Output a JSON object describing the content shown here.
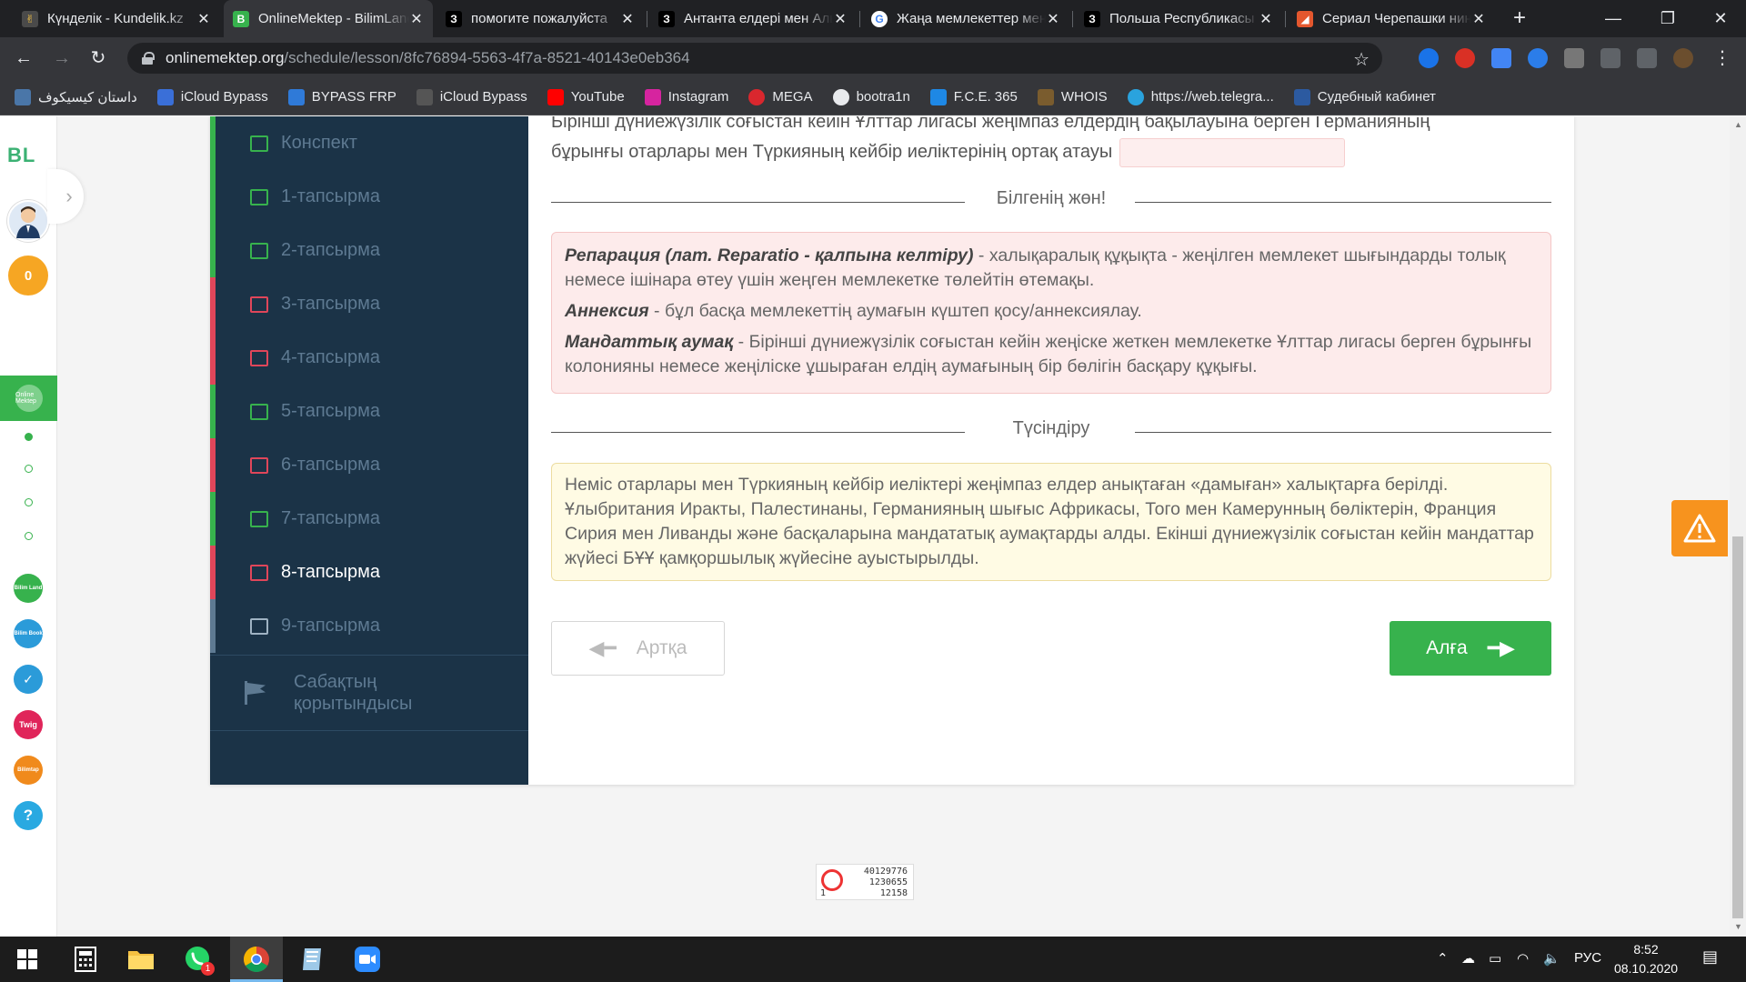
{
  "browser": {
    "tabs": [
      {
        "title": "Күнделік - Kundelik.kz",
        "fav_color": "#4a4a4a",
        "fav_glyph": "✌"
      },
      {
        "title": "OnlineMektep - BilimLand",
        "fav_color": "#37b24d",
        "fav_glyph": "B",
        "active": true
      },
      {
        "title": "помогите пожалуйста",
        "fav_color": "#000000",
        "fav_glyph": "З"
      },
      {
        "title": "Антанта елдері мен Аль",
        "fav_color": "#000000",
        "fav_glyph": "З"
      },
      {
        "title": "Жаңа мемлекеттер мен",
        "fav_color": "#ffffff",
        "fav_glyph": "G"
      },
      {
        "title": "Польша Республикасы",
        "fav_color": "#000000",
        "fav_glyph": "З"
      },
      {
        "title": "Сериал Черепашки ниндзя",
        "fav_color": "#e4572e",
        "fav_glyph": "◢"
      }
    ],
    "url_host": "onlinemektep.org",
    "url_path": "/schedule/lesson/8fc76894-5563-4f7a-8521-40143e0eb364",
    "bookmarks": [
      {
        "label": "داستان کیسیکوف",
        "color": "#4a76a8"
      },
      {
        "label": "iCloud Bypass",
        "color": "#3a6fd8"
      },
      {
        "label": "BYPASS FRP",
        "color": "#2f7ad8"
      },
      {
        "label": "iCloud Bypass",
        "color": "#555555"
      },
      {
        "label": "YouTube",
        "color": "#ff0000"
      },
      {
        "label": "Instagram",
        "color": "#d6249f"
      },
      {
        "label": "MEGA",
        "color": "#d9272e"
      },
      {
        "label": "bootra1n",
        "color": "#333333"
      },
      {
        "label": "F.C.E. 365",
        "color": "#1e88e5"
      },
      {
        "label": "WHOIS",
        "color": "#7a5c2e"
      },
      {
        "label": "https://web.telegra...",
        "color": "#2aa3de"
      },
      {
        "label": "Судебный кабинет",
        "color": "#2c5aa0"
      }
    ]
  },
  "rail": {
    "logo": "BL",
    "coins": "0",
    "active_app": "Online Mektep",
    "apps": [
      {
        "label": "Bilim Land",
        "color": "#37b24d"
      },
      {
        "label": "Bilim Book",
        "color": "#2b9bd9"
      },
      {
        "label": "✓",
        "color": "#2b9bd9"
      },
      {
        "label": "Twig",
        "color": "#e0255a"
      },
      {
        "label": "Bilimtap",
        "color": "#f08a1c"
      },
      {
        "label": "?",
        "color": "#29a9e1"
      }
    ]
  },
  "sidenav": {
    "items": [
      {
        "label": "Конспект",
        "state": "konspekt"
      },
      {
        "label": "1-тапсырма",
        "state": "done"
      },
      {
        "label": "2-тапсырма",
        "state": "done"
      },
      {
        "label": "3-тапсырма",
        "state": "fail"
      },
      {
        "label": "4-тапсырма",
        "state": "fail"
      },
      {
        "label": "5-тапсырма",
        "state": "done"
      },
      {
        "label": "6-тапсырма",
        "state": "fail"
      },
      {
        "label": "7-тапсырма",
        "state": "done"
      },
      {
        "label": "8-тапсырма",
        "state": "fail",
        "current": true
      },
      {
        "label": "9-тапсырма",
        "state": "none"
      }
    ],
    "footer": "Сабақтың қорытындысы"
  },
  "task": {
    "question_line1": "Бірінші дүниежүзілік соғыстан кейін Ұлттар лигасы жеңімпаз елдердің бақылауына берген Германияның",
    "question_line2": "бұрынғы отарлары мен Түркияның кейбір иеліктерінің ортақ атауы",
    "know_title": "Білгенің жөн!",
    "know": [
      {
        "term": "Репарация (лат. Reparatio - қалпына келтіру)",
        "text": " - халықаралық құқықта - жеңілген мемлекет шығындарды толық немесе ішінара өтеу үшін жеңген мемлекетке төлейтін өтемақы."
      },
      {
        "term": "Аннексия",
        "text": " - бұл басқа мемлекеттің аумағын күштеп қосу/аннексиялау."
      },
      {
        "term": "Мандаттық аумақ",
        "text": " - Бірінші дүниежүзілік соғыстан кейін жеңіске жеткен мемлекетке Ұлттар лигасы берген бұрынғы колонияны немесе жеңіліске ұшыраған елдің аумағының бір бөлігін басқару құқығы."
      }
    ],
    "expl_title": "Түсіндіру",
    "explanation": "Неміс отарлары мен Түркияның кейбір иеліктері жеңімпаз елдер анықтаған «дамыған» халықтарға берілді. Ұлыбритания Иракты, Палестинаны, Германияның шығыс Африкасы, Того мен Камерунның бөліктерін, Франция Сирия мен Ливанды және басқаларына мандататық аумақтарды алды. Екінші дүниежүзілік соғыстан кейін мандаттар жүйесі БҰҰ қамқоршылық жүйесіне ауыстырылды.",
    "back_label": "Артқа",
    "next_label": "Алға"
  },
  "counter": {
    "a": "40129776",
    "b": "1230655",
    "c": "1",
    "d": "12158"
  },
  "taskbar": {
    "lang": "РУС",
    "time": "8:52",
    "date": "08.10.2020",
    "whatsapp_badge": "1"
  },
  "colors": {
    "accent": "#37b24d",
    "fail": "#e0465a",
    "nav_bg": "#1b3347",
    "warn": "#f7931e"
  }
}
